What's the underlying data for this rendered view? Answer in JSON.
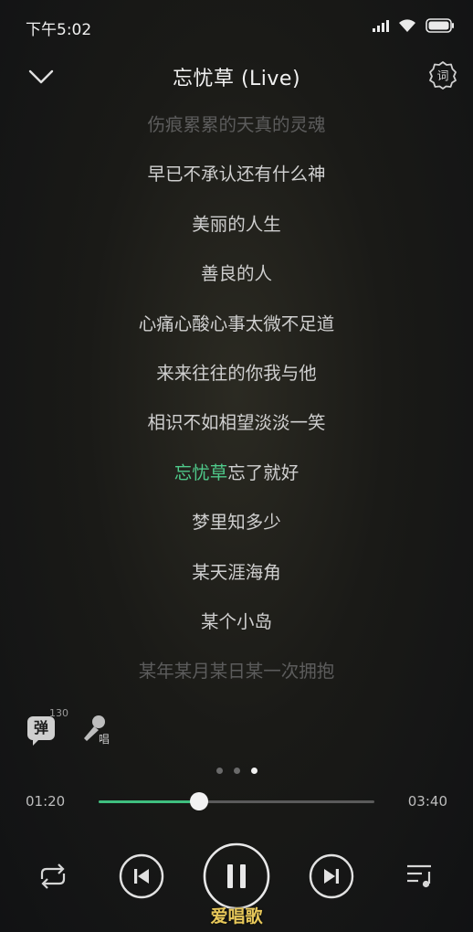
{
  "status_bar": {
    "time": "下午5:02"
  },
  "header": {
    "title": "忘忧草 (Live)"
  },
  "lyrics": {
    "lines": [
      {
        "text": "伤痕累累的天真的灵魂",
        "state": "faded"
      },
      {
        "text": "早已不承认还有什么神",
        "state": "normal"
      },
      {
        "text": "美丽的人生",
        "state": "normal"
      },
      {
        "text": "善良的人",
        "state": "normal"
      },
      {
        "text": "心痛心酸心事太微不足道",
        "state": "normal"
      },
      {
        "text": "来来往往的你我与他",
        "state": "normal"
      },
      {
        "text": "相识不如相望淡淡一笑",
        "state": "normal"
      },
      {
        "highlight": "忘忧草",
        "rest": "忘了就好",
        "state": "current"
      },
      {
        "text": "梦里知多少",
        "state": "normal"
      },
      {
        "text": "某天涯海角",
        "state": "normal"
      },
      {
        "text": "某个小岛",
        "state": "normal"
      },
      {
        "text": "某年某月某日某一次拥抱",
        "state": "faded"
      }
    ]
  },
  "actions": {
    "danmu_label": "弹",
    "danmu_count": "130",
    "sing_label": "唱"
  },
  "player": {
    "current_time": "01:20",
    "total_time": "03:40",
    "progress_fraction": 0.3636,
    "page_count": 3,
    "active_page": 2
  },
  "colors": {
    "accent": "#3fbf7f",
    "highlight_text": "#4fc98a"
  },
  "watermark": "爱唱歌"
}
